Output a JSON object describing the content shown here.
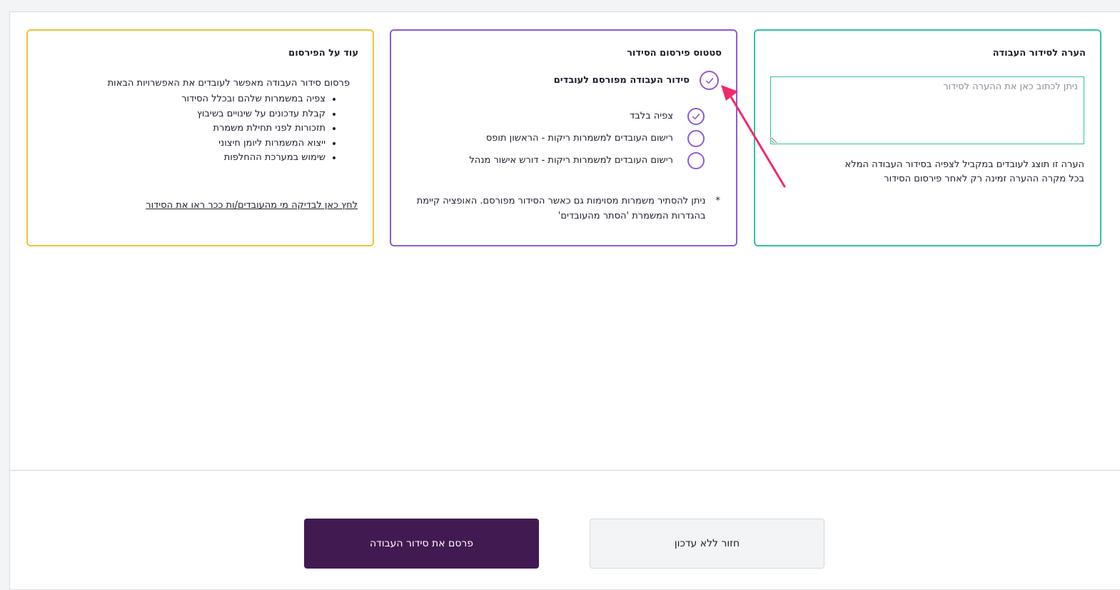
{
  "note_card": {
    "title": "הערה לסידור העבודה",
    "placeholder": "ניתן לכתוב כאן את ההערה לסידור",
    "help_line1": "הערה זו תוצג לעובדים במקביל לצפיה בסידור העבודה המלא",
    "help_line2": "בכל מקרה ההערה זמינה רק לאחר פירסום הסידור"
  },
  "status_card": {
    "title": "סטטוס פירסום הסידור",
    "main_status": "סידור העבודה מפורסם לעובדים",
    "options": [
      {
        "label": "צפיה בלבד",
        "selected": true
      },
      {
        "label": "רישום העובדים למשמרות ריקות - הראשון תופס",
        "selected": false
      },
      {
        "label": "רישום העובדים למשמרות ריקות - דורש אישור מנהל",
        "selected": false
      }
    ],
    "footnote_mark": "*",
    "footnote_line1": "ניתן להסתיר משמרות מסוימות גם כאשר הסידור מפורסם. האופציה קיימת",
    "footnote_line2": "בהגדרות המשמרת 'הסתר מהעובדים'"
  },
  "more_card": {
    "title": "עוד על הפירסום",
    "intro": "פרסום סידור העבודה מאפשר לעובדים את האפשרויות הבאות",
    "bullets": [
      "צפיה במשמרות שלהם ובכלל הסידור",
      "קבלת עדכונים על שינויים בשיבוץ",
      "תזכורות לפני תחילת משמרת",
      "ייצוא המשמרות ליומן חיצוני",
      "שימוש במערכת ההחלפות"
    ],
    "link": "לחץ כאן לבדיקה מי מהעובדים/ות ככר ראו את הסידור"
  },
  "buttons": {
    "back": "חזור ללא עדכון",
    "publish": "פרסם את סידור העבודה"
  },
  "colors": {
    "note_border": "#2ec4a0",
    "status_border": "#8d5bd6",
    "more_border": "#f2c230",
    "publish_bg": "#421a52",
    "annotation_arrow": "#f0286e"
  }
}
